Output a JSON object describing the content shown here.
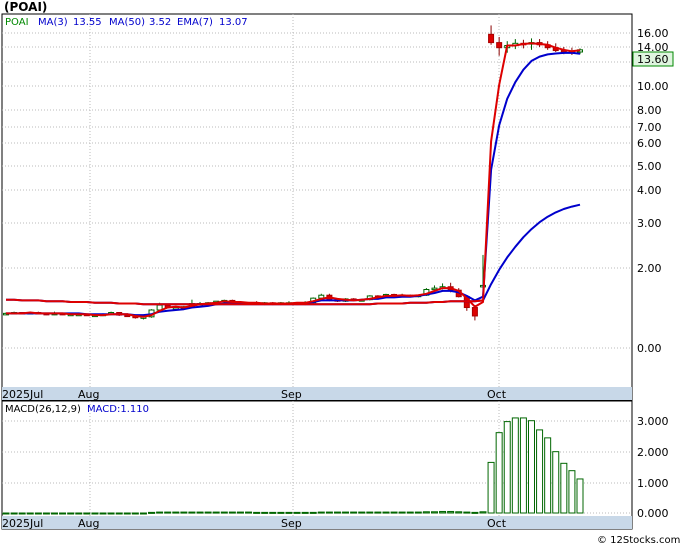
{
  "title": "(POAI)",
  "watermark": "© 12Stocks.com",
  "colors": {
    "up": "#ffffff",
    "down": "#dd0000",
    "ma3": "#dd0000",
    "ma50": "#0000cc",
    "ema7": "#0000cc",
    "macd": "#006600",
    "grid": "#bbbbbb",
    "xbar": "#c8d8e8",
    "lastTagBg": "#dff5df"
  },
  "chart_data": [
    {
      "type": "candlestick",
      "ticker": "POAI",
      "legend": [
        {
          "label": "POAI",
          "color": "#008800"
        },
        {
          "label": "MA(3)",
          "color": "#0000cc"
        },
        {
          "label": "13.55",
          "color": "#0000cc"
        },
        {
          "label": "MA(50)",
          "color": "#0000cc"
        },
        {
          "label": "3.52",
          "color": "#0000cc"
        },
        {
          "label": "EMA(7)",
          "color": "#0000cc"
        },
        {
          "label": "13.07",
          "color": "#0000cc"
        }
      ],
      "y_scale": "log",
      "y_ticks": [
        "0.00",
        "2.00",
        "3.00",
        "4.00",
        "5.00",
        "6.00",
        "7.00",
        "8.00",
        "10.00",
        "12.00",
        "14.00",
        "16.00"
      ],
      "last_price": "13.60",
      "x_labels": [
        "2025Jul",
        "Aug",
        "Sep",
        "Oct"
      ],
      "grid": true,
      "candles": [
        [
          1.34,
          1.36,
          1.33,
          1.35
        ],
        [
          1.35,
          1.37,
          1.34,
          1.36
        ],
        [
          1.36,
          1.36,
          1.34,
          1.35
        ],
        [
          1.35,
          1.37,
          1.34,
          1.36
        ],
        [
          1.36,
          1.37,
          1.34,
          1.35
        ],
        [
          1.35,
          1.36,
          1.33,
          1.34
        ],
        [
          1.34,
          1.37,
          1.33,
          1.35
        ],
        [
          1.35,
          1.36,
          1.33,
          1.34
        ],
        [
          1.34,
          1.35,
          1.33,
          1.34
        ],
        [
          1.34,
          1.36,
          1.33,
          1.34
        ],
        [
          1.34,
          1.34,
          1.32,
          1.33
        ],
        [
          1.33,
          1.34,
          1.32,
          1.33
        ],
        [
          1.33,
          1.35,
          1.32,
          1.34
        ],
        [
          1.34,
          1.37,
          1.33,
          1.36
        ],
        [
          1.36,
          1.36,
          1.32,
          1.33
        ],
        [
          1.33,
          1.35,
          1.31,
          1.32
        ],
        [
          1.32,
          1.32,
          1.29,
          1.3
        ],
        [
          1.3,
          1.32,
          1.28,
          1.31
        ],
        [
          1.31,
          1.4,
          1.3,
          1.39
        ],
        [
          1.39,
          1.48,
          1.38,
          1.45
        ],
        [
          1.45,
          1.47,
          1.41,
          1.42
        ],
        [
          1.42,
          1.44,
          1.4,
          1.42
        ],
        [
          1.42,
          1.44,
          1.41,
          1.43
        ],
        [
          1.43,
          1.52,
          1.42,
          1.47
        ],
        [
          1.47,
          1.49,
          1.45,
          1.47
        ],
        [
          1.47,
          1.49,
          1.46,
          1.48
        ],
        [
          1.48,
          1.5,
          1.47,
          1.5
        ],
        [
          1.5,
          1.52,
          1.48,
          1.51
        ],
        [
          1.51,
          1.52,
          1.46,
          1.47
        ],
        [
          1.47,
          1.49,
          1.46,
          1.48
        ],
        [
          1.48,
          1.49,
          1.46,
          1.48
        ],
        [
          1.48,
          1.5,
          1.46,
          1.47
        ],
        [
          1.47,
          1.49,
          1.45,
          1.48
        ],
        [
          1.48,
          1.49,
          1.45,
          1.46
        ],
        [
          1.46,
          1.49,
          1.45,
          1.48
        ],
        [
          1.48,
          1.5,
          1.46,
          1.48
        ],
        [
          1.48,
          1.49,
          1.45,
          1.47
        ],
        [
          1.47,
          1.5,
          1.45,
          1.48
        ],
        [
          1.48,
          1.55,
          1.47,
          1.54
        ],
        [
          1.54,
          1.6,
          1.52,
          1.58
        ],
        [
          1.58,
          1.6,
          1.5,
          1.52
        ],
        [
          1.52,
          1.54,
          1.49,
          1.5
        ],
        [
          1.5,
          1.54,
          1.49,
          1.53
        ],
        [
          1.53,
          1.54,
          1.5,
          1.51
        ],
        [
          1.51,
          1.53,
          1.5,
          1.52
        ],
        [
          1.52,
          1.58,
          1.51,
          1.57
        ],
        [
          1.57,
          1.58,
          1.53,
          1.55
        ],
        [
          1.55,
          1.6,
          1.54,
          1.59
        ],
        [
          1.59,
          1.6,
          1.55,
          1.56
        ],
        [
          1.56,
          1.6,
          1.55,
          1.58
        ],
        [
          1.58,
          1.59,
          1.56,
          1.57
        ],
        [
          1.57,
          1.59,
          1.55,
          1.58
        ],
        [
          1.58,
          1.68,
          1.57,
          1.66
        ],
        [
          1.66,
          1.72,
          1.64,
          1.68
        ],
        [
          1.68,
          1.75,
          1.66,
          1.7
        ],
        [
          1.7,
          1.76,
          1.62,
          1.65
        ],
        [
          1.65,
          1.68,
          1.55,
          1.56
        ],
        [
          1.56,
          1.58,
          1.38,
          1.42
        ],
        [
          1.42,
          1.45,
          1.27,
          1.32
        ],
        [
          1.7,
          2.25,
          1.65,
          1.72
        ],
        [
          15.8,
          17.2,
          14.3,
          14.6
        ],
        [
          14.6,
          15.4,
          12.8,
          13.9
        ],
        [
          13.9,
          14.8,
          13.2,
          14.2
        ],
        [
          14.2,
          15.1,
          13.7,
          14.5
        ],
        [
          14.5,
          15.0,
          13.8,
          14.4
        ],
        [
          14.4,
          15.2,
          13.6,
          14.6
        ],
        [
          14.6,
          15.1,
          14.0,
          14.3
        ],
        [
          14.3,
          14.8,
          13.6,
          13.9
        ],
        [
          13.9,
          14.5,
          13.3,
          13.5
        ],
        [
          13.5,
          14.0,
          13.0,
          13.4
        ],
        [
          13.4,
          13.9,
          12.9,
          13.3
        ],
        [
          13.3,
          13.8,
          13.0,
          13.6
        ]
      ],
      "ma3": [
        1.35,
        1.35,
        1.35,
        1.36,
        1.35,
        1.35,
        1.35,
        1.35,
        1.34,
        1.34,
        1.34,
        1.33,
        1.33,
        1.34,
        1.34,
        1.34,
        1.32,
        1.31,
        1.33,
        1.38,
        1.42,
        1.43,
        1.42,
        1.44,
        1.46,
        1.47,
        1.48,
        1.5,
        1.49,
        1.49,
        1.48,
        1.48,
        1.47,
        1.47,
        1.47,
        1.47,
        1.48,
        1.48,
        1.5,
        1.53,
        1.55,
        1.53,
        1.52,
        1.51,
        1.52,
        1.53,
        1.55,
        1.57,
        1.57,
        1.58,
        1.57,
        1.58,
        1.6,
        1.64,
        1.68,
        1.68,
        1.64,
        1.54,
        1.43,
        1.49,
        6.1,
        10.1,
        14.2,
        14.2,
        14.4,
        14.5,
        14.4,
        14.3,
        13.9,
        13.6,
        13.4,
        13.55
      ],
      "ma50": [
        1.52,
        1.52,
        1.51,
        1.51,
        1.51,
        1.5,
        1.5,
        1.5,
        1.49,
        1.49,
        1.49,
        1.48,
        1.48,
        1.48,
        1.47,
        1.47,
        1.47,
        1.46,
        1.46,
        1.46,
        1.46,
        1.46,
        1.46,
        1.46,
        1.46,
        1.46,
        1.46,
        1.46,
        1.46,
        1.46,
        1.46,
        1.46,
        1.46,
        1.46,
        1.46,
        1.46,
        1.46,
        1.46,
        1.46,
        1.46,
        1.46,
        1.46,
        1.46,
        1.46,
        1.46,
        1.46,
        1.47,
        1.47,
        1.47,
        1.47,
        1.48,
        1.48,
        1.48,
        1.49,
        1.49,
        1.5,
        1.5,
        1.5,
        1.5,
        1.51,
        1.74,
        1.97,
        2.2,
        2.42,
        2.64,
        2.84,
        3.02,
        3.17,
        3.29,
        3.39,
        3.46,
        3.52
      ],
      "ema7": [
        1.35,
        1.35,
        1.35,
        1.35,
        1.35,
        1.35,
        1.35,
        1.35,
        1.35,
        1.35,
        1.34,
        1.34,
        1.34,
        1.34,
        1.34,
        1.34,
        1.33,
        1.33,
        1.34,
        1.37,
        1.38,
        1.39,
        1.4,
        1.42,
        1.43,
        1.44,
        1.46,
        1.47,
        1.47,
        1.47,
        1.47,
        1.47,
        1.47,
        1.47,
        1.47,
        1.47,
        1.47,
        1.47,
        1.49,
        1.51,
        1.51,
        1.51,
        1.51,
        1.51,
        1.52,
        1.53,
        1.53,
        1.55,
        1.55,
        1.56,
        1.56,
        1.57,
        1.59,
        1.61,
        1.64,
        1.64,
        1.62,
        1.57,
        1.51,
        1.56,
        4.83,
        7.1,
        8.88,
        10.29,
        11.32,
        12.14,
        12.68,
        12.98,
        13.1,
        13.17,
        13.2,
        13.07
      ],
      "macd_label": "MACD(26,12,9)",
      "macd_value_label": "MACD:1.110",
      "macd_ticks": [
        "0.000",
        "1.000",
        "2.000",
        "3.000"
      ],
      "macd": [
        0,
        0,
        0,
        0,
        0,
        0,
        0,
        0,
        0,
        0,
        0,
        0,
        0,
        0,
        0,
        0,
        0,
        0,
        0.02,
        0.03,
        0.03,
        0.03,
        0.03,
        0.03,
        0.03,
        0.03,
        0.03,
        0.03,
        0.03,
        0.03,
        0.03,
        0.02,
        0.02,
        0.02,
        0.02,
        0.02,
        0.02,
        0.02,
        0.02,
        0.03,
        0.03,
        0.03,
        0.03,
        0.03,
        0.03,
        0.03,
        0.03,
        0.03,
        0.03,
        0.03,
        0.03,
        0.03,
        0.04,
        0.04,
        0.05,
        0.05,
        0.04,
        0.03,
        0.02,
        0.04,
        1.65,
        2.62,
        2.98,
        3.1,
        3.1,
        3.01,
        2.71,
        2.45,
        2.0,
        1.62,
        1.38,
        1.11
      ]
    }
  ]
}
